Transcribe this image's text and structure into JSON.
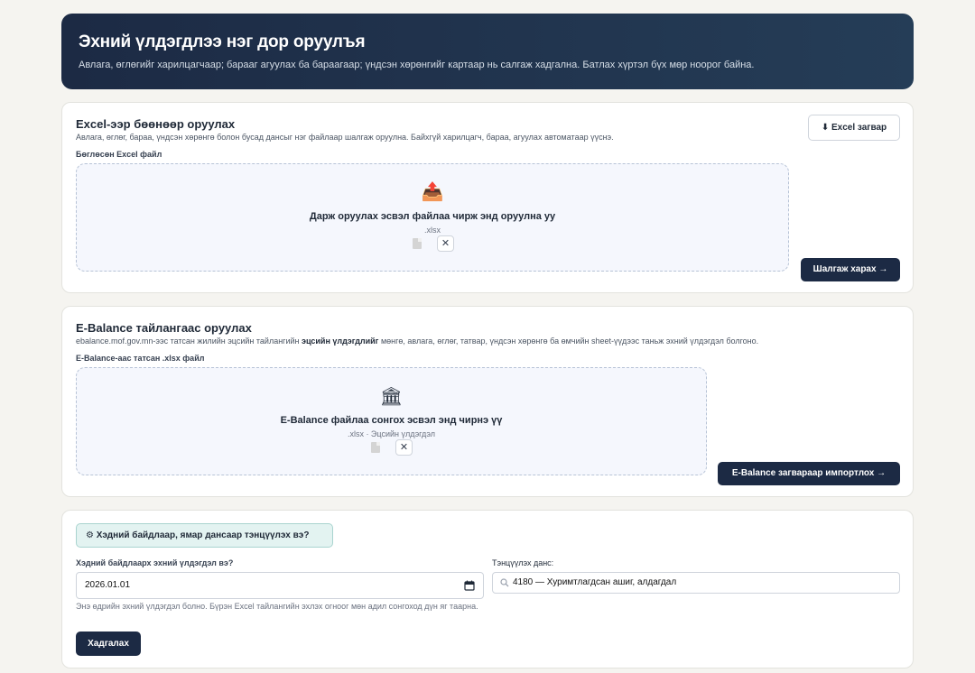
{
  "hero": {
    "title": "Эхний үлдэгдлээ нэг дор оруулъя",
    "subtitle": "Авлага, өглөгийг харилцагчаар; барааг агуулах ба бараагаар; үндсэн хөрөнгийг картаар нь салгаж хадгална. Батлах хүртэл бүх мөр ноорог байна."
  },
  "excel": {
    "title": "Excel-ээр бөөнөөр оруулах",
    "desc": "Авлага, өглөг, бараа, үндсэн хөрөнгө болон бусад дансыг нэг файлаар шалгаж оруулна. Байхгүй харилцагч, бараа, агуулах автоматаар үүснэ.",
    "template_btn": "⬇ Excel загвар",
    "field_label": "Бөглөсөн Excel файл",
    "drop_icon": "upload-tray-icon",
    "drop_title": "Дарж оруулах эсвэл файлаа чирж энд оруулна уу",
    "drop_sub": ".xlsx",
    "clear_label": "✕",
    "check_btn": "Шалгаж харах →"
  },
  "ebalance": {
    "title": "E-Balance тайлангаас оруулах",
    "desc_prefix": "ebalance.mof.gov.mn-ээс татсан жилийн эцсийн тайлангийн ",
    "desc_bold": "эцсийн үлдэгдлийг",
    "desc_suffix": " мөнгө, авлага, өглөг, татвар, үндсэн хөрөнгө ба өмчийн sheet-үүдээс таньж эхний үлдэгдэл болгоно.",
    "field_label": "E-Balance-аас татсан .xlsx файл",
    "drop_icon": "bank-icon",
    "drop_title": "E-Balance файлаа сонгох эсвэл энд чирнэ үү",
    "drop_sub": ".xlsx · Эцсийн үлдэгдэл",
    "clear_label": "✕",
    "import_btn": "E-Balance загвараар импортлох →"
  },
  "settings": {
    "pill": "⚙ Хэдний байдлаар, ямар дансаар тэнцүүлэх вэ?",
    "date_label": "Хэдний байдлаарх эхний үлдэгдэл вэ?",
    "date_value": "2026.01.01",
    "helper": "Энэ өдрийн эхний үлдэгдэл болно. Бүрэн Excel тайлангийн эхлэх огноог мөн адил сонгоход дүн яг таарна.",
    "account_label": "Тэнцүүлэх данс:",
    "account_value": "4180 — Хуримтлагдсан ашиг, алдагдал",
    "save_btn": "Хадгалах"
  }
}
